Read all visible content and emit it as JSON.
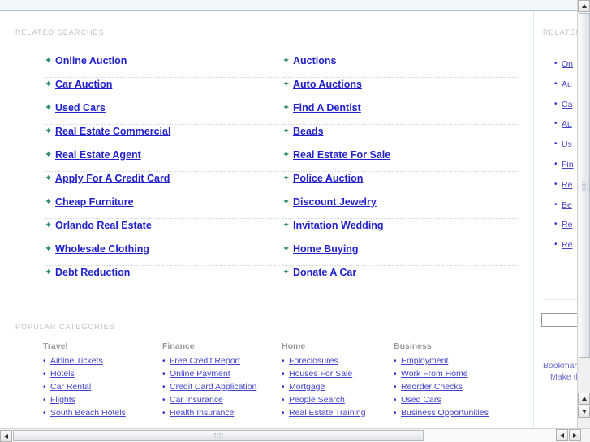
{
  "page": {
    "related_searches_label": "RELATED SEARCHES",
    "popular_categories_label": "POPULAR CATEGORIES"
  },
  "related_searches": {
    "left_column": [
      "Online Auction",
      "Car Auction",
      "Used Cars",
      "Real Estate Commercial",
      "Real Estate Agent",
      "Apply For A Credit Card",
      "Cheap Furniture",
      "Orlando Real Estate",
      "Wholesale Clothing",
      "Debt Reduction"
    ],
    "right_column": [
      "Auctions",
      "Auto Auctions",
      "Find A Dentist",
      "Beads",
      "Real Estate For Sale",
      "Police Auction",
      "Discount Jewelry",
      "Invitation Wedding",
      "Home Buying",
      "Donate A Car"
    ]
  },
  "popular_categories": [
    {
      "title": "Travel",
      "items": [
        "Airline Tickets",
        "Hotels",
        "Car Rental",
        "Flights",
        "South Beach Hotels"
      ]
    },
    {
      "title": "Finance",
      "items": [
        "Free Credit Report",
        "Online Payment",
        "Credit Card Application",
        "Car Insurance",
        "Health Insurance"
      ]
    },
    {
      "title": "Home",
      "items": [
        "Foreclosures",
        "Houses For Sale",
        "Mortgage",
        "People Search",
        "Real Estate Training"
      ]
    },
    {
      "title": "Business",
      "items": [
        "Employment",
        "Work From Home",
        "Reorder Checks",
        "Used Cars",
        "Business Opportunities"
      ]
    }
  ],
  "side_panel": {
    "label": "RELATED",
    "links": [
      "On",
      "Au",
      "Ca",
      "Au",
      "Us",
      "Fin",
      "Re",
      "Be",
      "Re",
      "Re"
    ],
    "search_value": "",
    "search_placeholder": "",
    "footer_line1": "Bookmark",
    "footer_line2": "Make thi"
  },
  "icons": {
    "star_bullet": "✦",
    "dot_bullet": "•"
  },
  "colors": {
    "link": "#2222cc",
    "star": "#2e8b72",
    "label": "#c3c3c3",
    "header_band": "#f2f7fb",
    "header_border": "#a9c5de"
  }
}
